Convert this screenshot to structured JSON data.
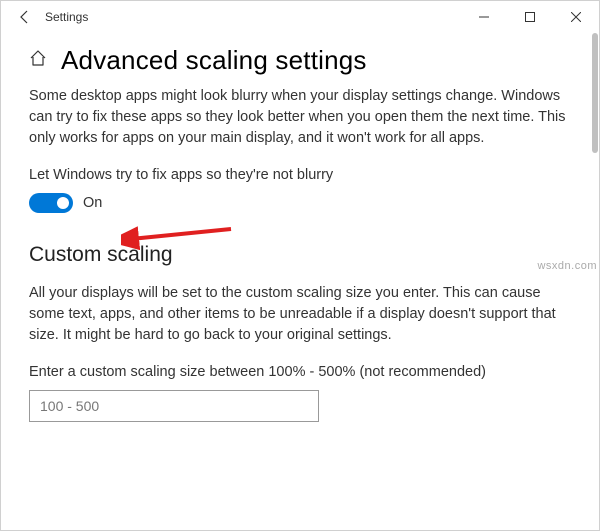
{
  "window": {
    "title": "Settings"
  },
  "page": {
    "title": "Advanced scaling settings",
    "intro": "Some desktop apps might look blurry when your display settings change. Windows can try to fix these apps so they look better when you open them the next time. This only works for apps on your main display, and it won't work for all apps.",
    "fix_blurry": {
      "label": "Let Windows try to fix apps so they're not blurry",
      "state_label": "On"
    },
    "custom_scaling": {
      "heading": "Custom scaling",
      "description": "All your displays will be set to the custom scaling size you enter. This can cause some text, apps, and other items to be unreadable if a display doesn't support that size. It might be hard to go back to your original settings.",
      "input_label": "Enter a custom scaling size between 100% - 500% (not recommended)",
      "placeholder": "100 - 500"
    }
  },
  "watermark": "wsxdn.com",
  "colors": {
    "accent": "#0078d7"
  }
}
